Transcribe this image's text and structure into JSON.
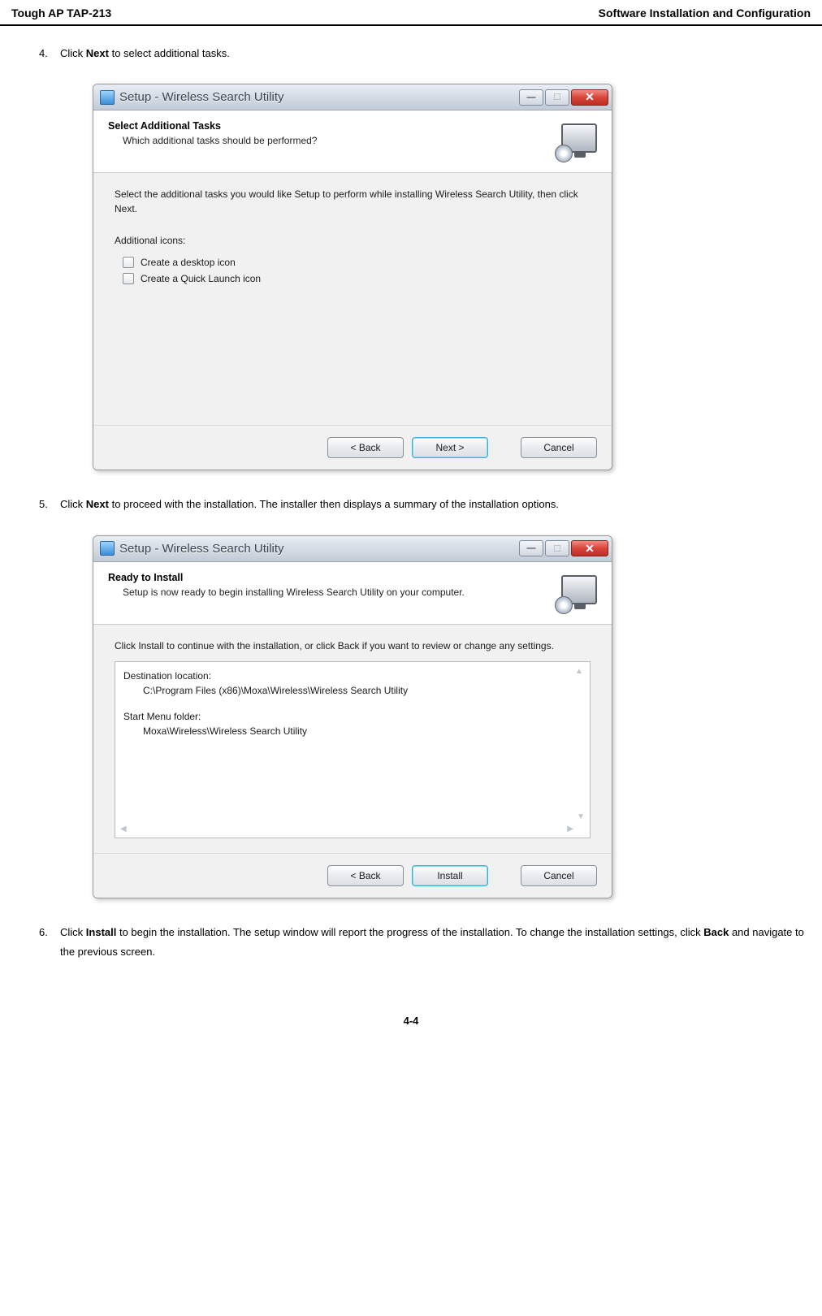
{
  "header": {
    "left": "Tough AP TAP-213",
    "right": "Software Installation and Configuration"
  },
  "step4": {
    "num": "4.",
    "text_before": "Click ",
    "bold": "Next",
    "text_after": " to select additional tasks."
  },
  "win1": {
    "title": "Setup - Wireless Search Utility",
    "heading": "Select Additional Tasks",
    "subheading": "Which additional tasks should be performed?",
    "instruction": "Select the additional tasks you would like Setup to perform while installing Wireless Search Utility, then click Next.",
    "section_label": "Additional icons:",
    "chk1": "Create a desktop icon",
    "chk2": "Create a Quick Launch icon",
    "btn_back": "< Back",
    "btn_next": "Next >",
    "btn_cancel": "Cancel"
  },
  "step5": {
    "num": "5.",
    "text_before": "Click ",
    "bold": "Next",
    "text_after": " to proceed with the installation. The installer then displays a summary of the installation options."
  },
  "win2": {
    "title": "Setup - Wireless Search Utility",
    "heading": "Ready to Install",
    "subheading": "Setup is now ready to begin installing Wireless Search Utility on your computer.",
    "instruction": "Click Install to continue with the installation, or click Back if you want to review or change any settings.",
    "dest_label": "Destination location:",
    "dest_value": "C:\\Program Files (x86)\\Moxa\\Wireless\\Wireless Search Utility",
    "start_label": "Start Menu folder:",
    "start_value": "Moxa\\Wireless\\Wireless Search Utility",
    "btn_back": "< Back",
    "btn_install": "Install",
    "btn_cancel": "Cancel"
  },
  "step6": {
    "num": "6.",
    "text_before": "Click ",
    "bold1": "Install",
    "text_mid": " to begin the installation. The setup window will report the progress of the installation. To change the installation settings, click ",
    "bold2": "Back",
    "text_after": " and navigate to the previous screen."
  },
  "footer": "4-4"
}
